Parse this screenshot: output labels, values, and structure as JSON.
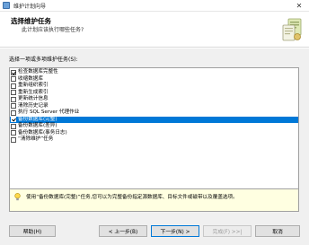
{
  "window": {
    "title": "维护计划向导",
    "close_glyph": "✕"
  },
  "header": {
    "title": "选择维护任务",
    "subtitle": "此计划应该执行哪些任务?"
  },
  "main": {
    "prompt": "选择一项或多项维护任务(S):",
    "tasks": [
      {
        "label": "检查数据库完整性",
        "checked": true
      },
      {
        "label": "收缩数据库",
        "checked": false
      },
      {
        "label": "重新组织索引",
        "checked": false
      },
      {
        "label": "重新生成索引",
        "checked": false
      },
      {
        "label": "更新统计信息",
        "checked": false
      },
      {
        "label": "清除历史记录",
        "checked": false
      },
      {
        "label": "执行 SQL Server 代理作业",
        "checked": false
      },
      {
        "label": "备份数据库(完整)",
        "checked": true,
        "selected": true
      },
      {
        "label": "备份数据库(差异)",
        "checked": false
      },
      {
        "label": "备份数据库(事务日志)",
        "checked": false
      },
      {
        "label": "“清除维护”任务",
        "checked": false
      }
    ],
    "description": "使用“备份数据库(完整)”任务,您可以为完整备份指定源数据库、目标文件或磁带以及覆盖选项。"
  },
  "footer": {
    "help": "帮助(H)",
    "back": "< 上一步(B)",
    "next": "下一步(N) >",
    "finish": "完成(F) >>|",
    "cancel": "取消"
  },
  "colors": {
    "selection": "#0078d7",
    "description_bg": "#ffffe1",
    "accent": "#0078d7"
  },
  "icons": {
    "window": "maintenance-plan-icon",
    "info": "lightbulb-icon",
    "header": "wizard-graphic-icon"
  }
}
